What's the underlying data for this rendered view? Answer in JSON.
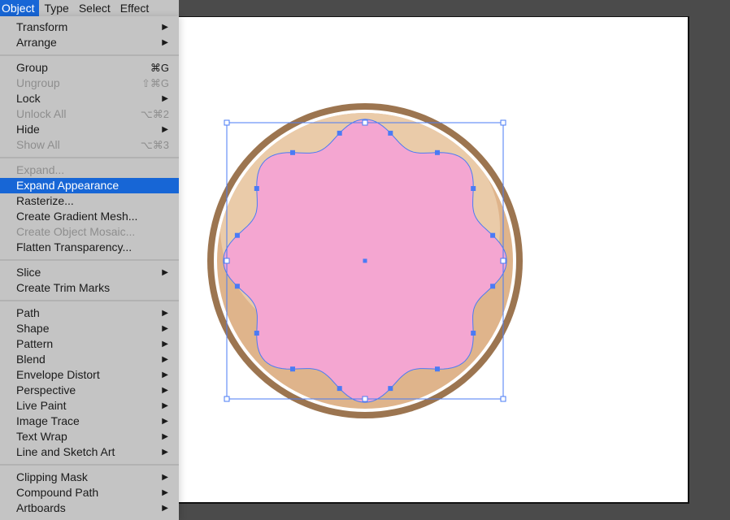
{
  "menubar": {
    "items": [
      {
        "label": "Object",
        "active": true
      },
      {
        "label": "Type"
      },
      {
        "label": "Select"
      },
      {
        "label": "Effect"
      }
    ]
  },
  "menu": {
    "groups": [
      [
        {
          "label": "Transform",
          "submenu": true
        },
        {
          "label": "Arrange",
          "submenu": true
        }
      ],
      [
        {
          "label": "Group",
          "shortcut": "⌘G"
        },
        {
          "label": "Ungroup",
          "shortcut": "⇧⌘G",
          "disabled": true
        },
        {
          "label": "Lock",
          "submenu": true
        },
        {
          "label": "Unlock All",
          "shortcut": "⌥⌘2",
          "disabled": true
        },
        {
          "label": "Hide",
          "submenu": true
        },
        {
          "label": "Show All",
          "shortcut": "⌥⌘3",
          "disabled": true
        }
      ],
      [
        {
          "label": "Expand...",
          "disabled": true
        },
        {
          "label": "Expand Appearance",
          "highlighted": true
        },
        {
          "label": "Rasterize..."
        },
        {
          "label": "Create Gradient Mesh..."
        },
        {
          "label": "Create Object Mosaic...",
          "disabled": true
        },
        {
          "label": "Flatten Transparency..."
        }
      ],
      [
        {
          "label": "Slice",
          "submenu": true
        },
        {
          "label": "Create Trim Marks"
        }
      ],
      [
        {
          "label": "Path",
          "submenu": true
        },
        {
          "label": "Shape",
          "submenu": true
        },
        {
          "label": "Pattern",
          "submenu": true
        },
        {
          "label": "Blend",
          "submenu": true
        },
        {
          "label": "Envelope Distort",
          "submenu": true
        },
        {
          "label": "Perspective",
          "submenu": true
        },
        {
          "label": "Live Paint",
          "submenu": true
        },
        {
          "label": "Image Trace",
          "submenu": true
        },
        {
          "label": "Text Wrap",
          "submenu": true
        },
        {
          "label": "Line and Sketch Art",
          "submenu": true
        }
      ],
      [
        {
          "label": "Clipping Mask",
          "submenu": true
        },
        {
          "label": "Compound Path",
          "submenu": true
        },
        {
          "label": "Artboards",
          "submenu": true
        }
      ]
    ],
    "submenu_arrow": "▶"
  },
  "artwork": {
    "description": "donut with pink wavy frosting, selected",
    "colors": {
      "rim": "#9c7550",
      "dough_light": "#eacba9",
      "dough_dark": "#dfb48b",
      "frosting": "#f4a6d1",
      "selection": "#4a7bf5",
      "highlight": "#ffffff"
    }
  }
}
